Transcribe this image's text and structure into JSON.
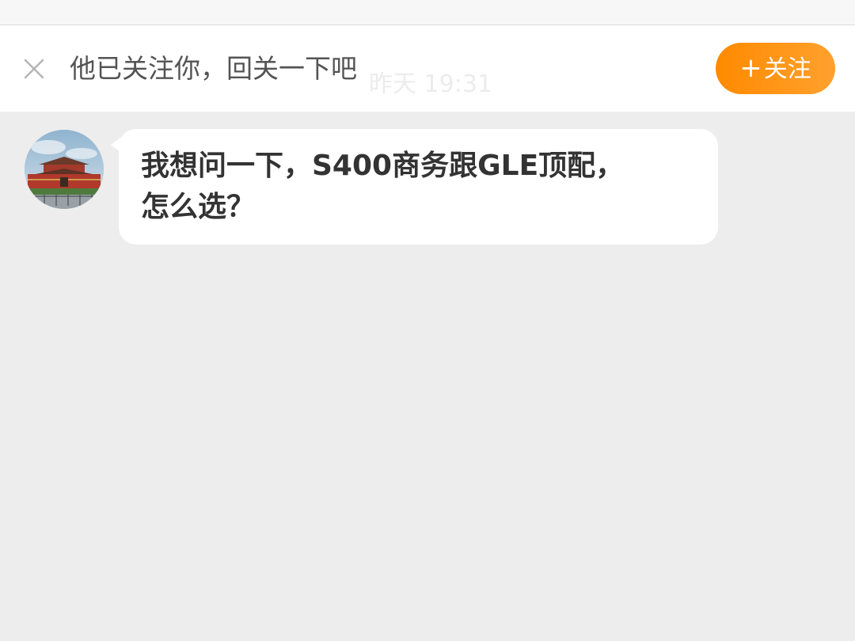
{
  "follow_bar": {
    "prompt": "他已关注你，回关一下吧",
    "follow_button_plus": "+",
    "follow_button_label": "关注",
    "time_separator": "昨天 19:31",
    "close_icon": "close-icon"
  },
  "conversation": {
    "messages": [
      {
        "sender": "other",
        "avatar_icon": "avatar-image",
        "text": "我想问一下，S400商务跟GLE顶配，\n怎么选？"
      }
    ]
  },
  "colors": {
    "accent_start": "#ff8a00",
    "accent_end": "#ffa12e",
    "chat_background": "#ededed",
    "bubble": "#ffffff"
  }
}
